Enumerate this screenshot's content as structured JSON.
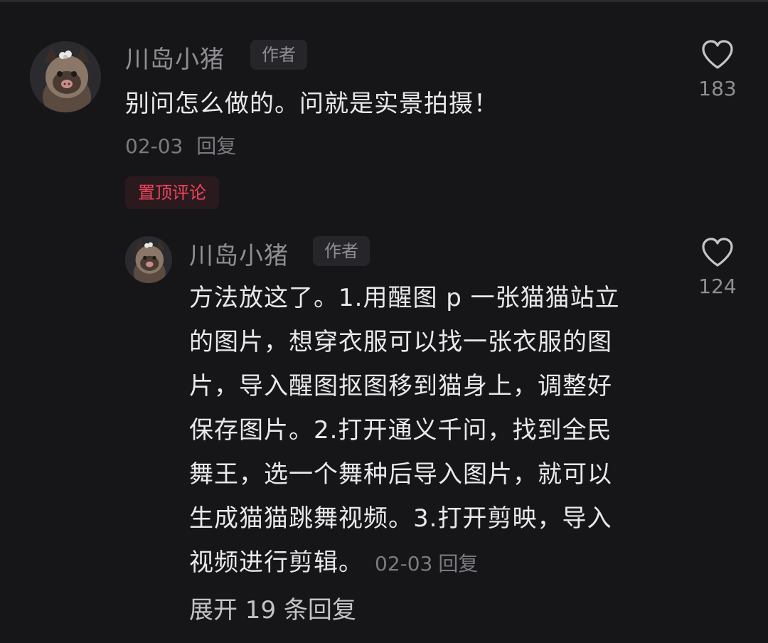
{
  "comment": {
    "username": "川岛小猪",
    "author_badge": "作者",
    "text": "别问怎么做的。问就是实景拍摄！",
    "date": "02-03",
    "reply_label": "回复",
    "like_count": "183",
    "pinned_label": "置顶评论"
  },
  "reply": {
    "username": "川岛小猪",
    "author_badge": "作者",
    "lines": [
      "方法放这了。1.用醒图 p 一张猫猫站立",
      "的图片，想穿衣服可以找一张衣服的图",
      "片，导入醒图抠图移到猫身上，调整好",
      "保存图片。2.打开通义千问，找到全民",
      "舞王，选一个舞种后导入图片，就可以",
      "生成猫猫跳舞视频。3.打开剪映，导入",
      "视频进行剪辑。"
    ],
    "date": "02-03",
    "reply_label": "回复",
    "like_count": "124"
  },
  "expand_replies": "展开 19 条回复",
  "colors": {
    "background": "#161619",
    "text_primary": "#e9e9ec",
    "text_secondary": "#8e8e93",
    "pinned_accent": "#f2435d"
  },
  "icons": {
    "like": "heart-outline-icon",
    "avatar": "cat-avatar"
  }
}
